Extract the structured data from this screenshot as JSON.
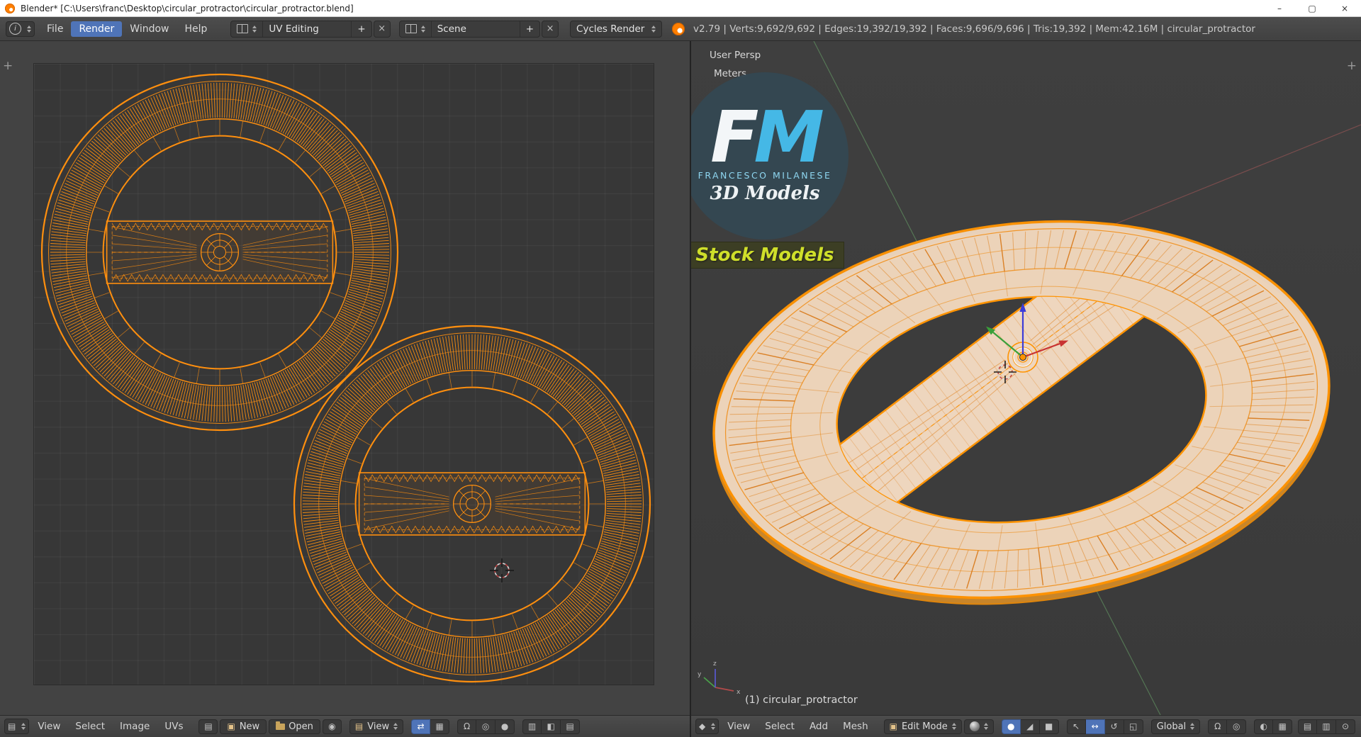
{
  "titlebar": {
    "title": "Blender* [C:\\Users\\franc\\Desktop\\circular_protractor\\circular_protractor.blend]"
  },
  "info_header": {
    "menus": [
      "File",
      "Render",
      "Window",
      "Help"
    ],
    "layout_value": "UV Editing",
    "scene_value": "Scene",
    "engine_value": "Cycles Render",
    "stats": "v2.79 | Verts:9,692/9,692 | Edges:19,392/19,392 | Faces:9,696/9,696 | Tris:19,392 | Mem:42.16M | circular_protractor"
  },
  "uv_editor": {
    "header": {
      "menus": [
        "View",
        "Select",
        "Image",
        "UVs"
      ],
      "btn_new": "New",
      "btn_open": "Open",
      "dd_view": "View"
    }
  },
  "viewport": {
    "view_name": "User Persp",
    "units": "Meters",
    "object_info": "(1) circular_protractor",
    "header": {
      "menus": [
        "View",
        "Select",
        "Add",
        "Mesh"
      ],
      "mode": "Edit Mode",
      "orientation": "Global"
    },
    "watermark": {
      "f": "F",
      "m": "M",
      "author": "FRANCESCO MILANESE",
      "line2": "3D Models",
      "banner": "Stock Models"
    },
    "axes": {
      "x": "x",
      "y": "y",
      "z": "z"
    }
  },
  "icons": {
    "info_editor": "i",
    "window_minimize": "–",
    "window_maximize": "▢",
    "window_close": "×",
    "plus": "+",
    "close_x": "×",
    "corner_plus": "+",
    "uv_editor_type": "▤",
    "image_browse": "▤",
    "image_new": "▣",
    "pin": "◉",
    "display_view": "▤",
    "uv_tools": [
      "⇄",
      "▦",
      "Ω",
      "◎",
      "●",
      "▥",
      "◧",
      "▤"
    ],
    "v3d_editor_type": "◆",
    "mode_icon": "▣",
    "select_modes": [
      "●",
      "◢",
      "■"
    ],
    "manipulators": [
      "↖",
      "↔",
      "↺",
      "◱"
    ],
    "v3d_tools_a": [
      "Ω",
      "◎"
    ],
    "v3d_tools_b": [
      "◐",
      "▦"
    ],
    "v3d_tools_c": [
      "▤",
      "▥",
      "⊙"
    ]
  },
  "colors": {
    "wire_orange": "#ff8f0e",
    "accent_blue": "#4f74b8",
    "logo_blue": "#45b8e6",
    "banner_text": "#cfdf2a",
    "face_fill": "#eed6be"
  }
}
